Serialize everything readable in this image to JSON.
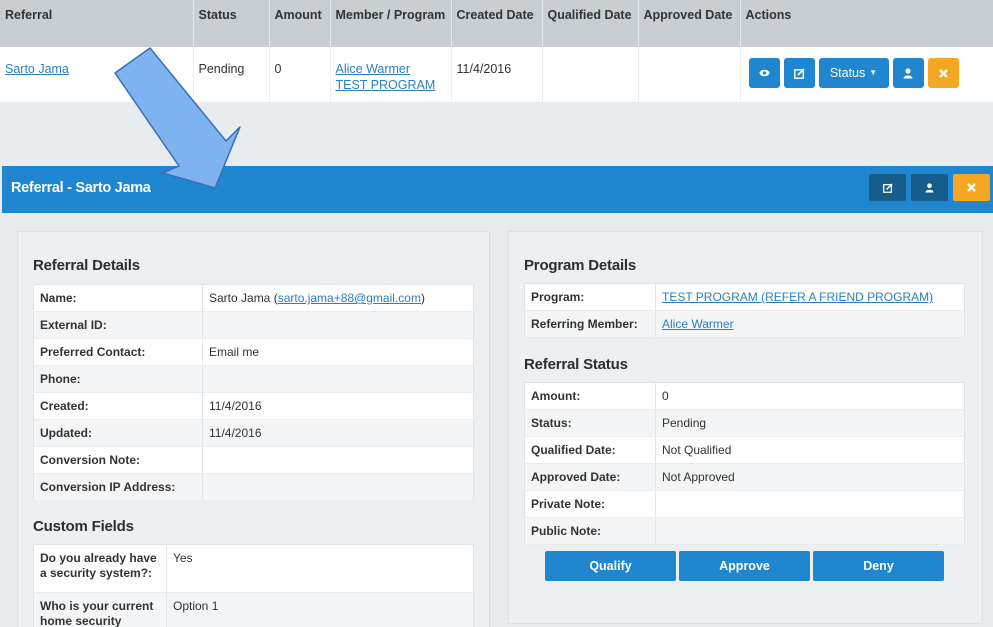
{
  "table": {
    "headers": [
      "Referral",
      "Status",
      "Amount",
      "Member / Program",
      "Created Date",
      "Qualified Date",
      "Approved Date",
      "Actions"
    ],
    "row": {
      "referral": "Sarto Jama",
      "status": "Pending",
      "amount": "0",
      "member": "Alice Warmer",
      "program": "TEST PROGRAM",
      "created": "11/4/2016",
      "qualified": "",
      "approved": ""
    },
    "actions": {
      "view_icon": "eye-icon",
      "edit_icon": "edit-icon",
      "status_label": "Status",
      "user_icon": "user-icon",
      "delete_icon": "close-icon"
    }
  },
  "panel": {
    "title": "Referral - Sarto Jama"
  },
  "referral_details": {
    "title": "Referral Details",
    "rows": [
      {
        "k": "Name:",
        "v": "Sarto Jama (",
        "email": "sarto.jama+88@gmail.com",
        "tail": ")"
      },
      {
        "k": "External ID:",
        "v": ""
      },
      {
        "k": "Preferred Contact:",
        "v": "Email me"
      },
      {
        "k": "Phone:",
        "v": ""
      },
      {
        "k": "Created:",
        "v": "11/4/2016"
      },
      {
        "k": "Updated:",
        "v": "11/4/2016"
      },
      {
        "k": "Conversion Note:",
        "v": ""
      },
      {
        "k": "Conversion IP Address:",
        "v": ""
      }
    ]
  },
  "custom_fields": {
    "title": "Custom Fields",
    "rows": [
      {
        "k": "Do you already have a security system?:",
        "v": "Yes"
      },
      {
        "k": "Who is your current home security",
        "v": "Option 1"
      }
    ]
  },
  "program_details": {
    "title": "Program Details",
    "program_label": "Program:",
    "program_value": "TEST PROGRAM (REFER A FRIEND PROGRAM)",
    "member_label": "Referring Member:",
    "member_value": "Alice Warmer"
  },
  "referral_status": {
    "title": "Referral Status",
    "rows": [
      {
        "k": "Amount:",
        "v": "0"
      },
      {
        "k": "Status:",
        "v": "Pending"
      },
      {
        "k": "Qualified Date:",
        "v": "Not Qualified"
      },
      {
        "k": "Approved Date:",
        "v": "Not Approved"
      },
      {
        "k": "Private Note:",
        "v": ""
      },
      {
        "k": "Public Note:",
        "v": ""
      }
    ],
    "buttons": {
      "qualify": "Qualify",
      "approve": "Approve",
      "deny": "Deny"
    }
  },
  "colors": {
    "primary": "#1f86cf",
    "dark_button": "#165c8d",
    "warning": "#f5a623",
    "arrow": "#7fb2f0"
  }
}
